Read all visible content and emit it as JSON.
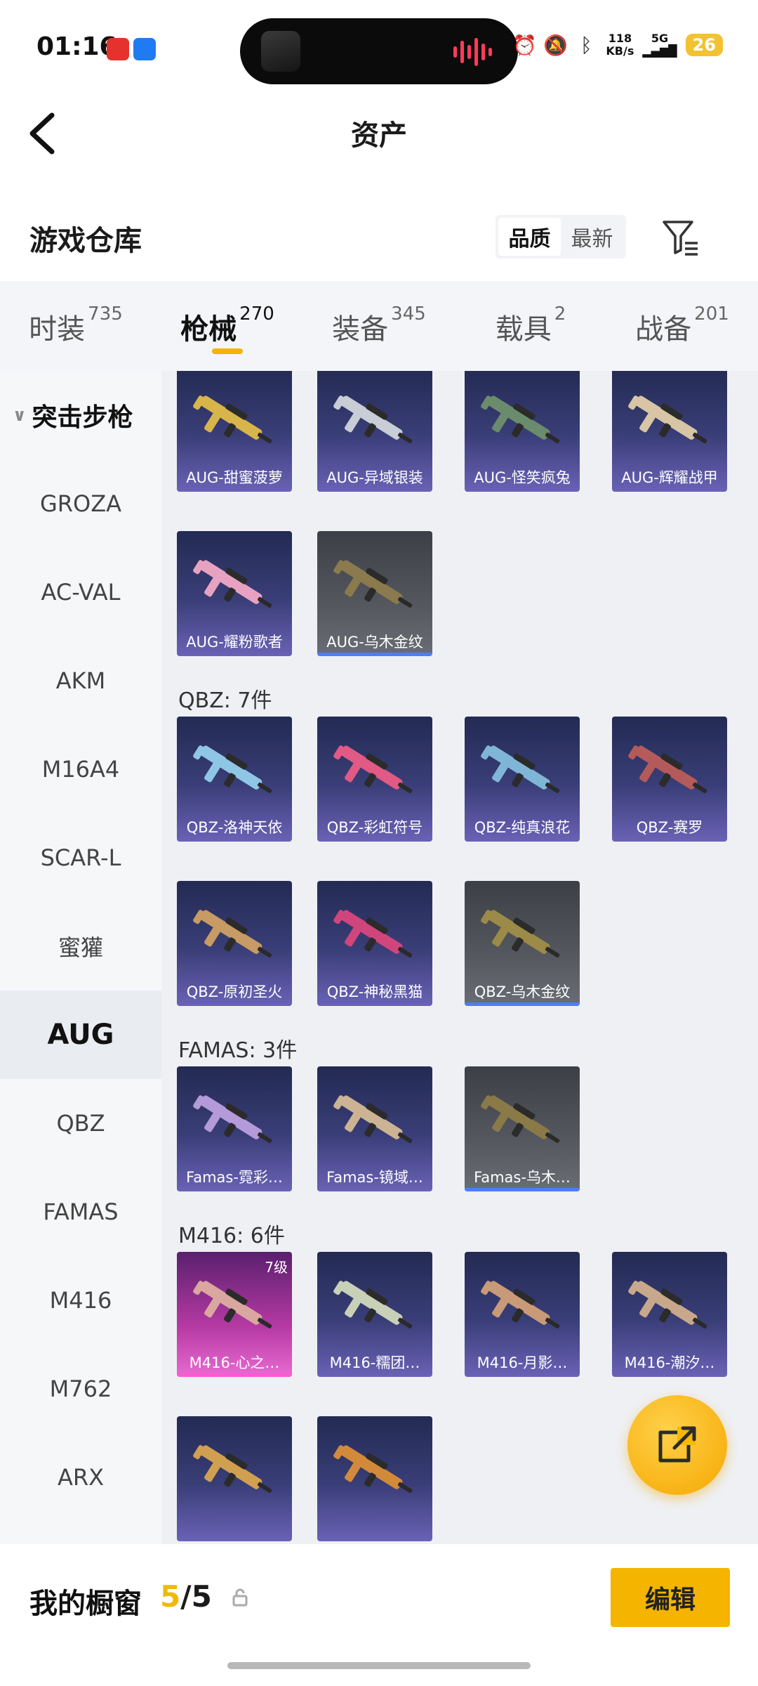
{
  "status_bar": {
    "time": "01:16",
    "net_speed_value": "118",
    "net_speed_unit": "KB/s",
    "network": "5G",
    "battery": "26"
  },
  "nav": {
    "title": "资产"
  },
  "section": {
    "title": "游戏仓库",
    "sort_options": [
      "品质",
      "最新"
    ],
    "active_sort": "品质"
  },
  "tabs": [
    {
      "label": "时装",
      "count": "735"
    },
    {
      "label": "枪械",
      "count": "270"
    },
    {
      "label": "装备",
      "count": "345"
    },
    {
      "label": "载具",
      "count": "2"
    },
    {
      "label": "战备",
      "count": "201"
    }
  ],
  "sidebar": {
    "group": "突击步枪",
    "items": [
      "GROZA",
      "AC-VAL",
      "AKM",
      "M16A4",
      "SCAR-L",
      "蜜獾",
      "AUG",
      "QBZ",
      "FAMAS",
      "M416",
      "M762",
      "ARX"
    ],
    "active": "AUG"
  },
  "groups": [
    {
      "title": "",
      "items": [
        "AUG-甜蜜菠萝",
        "AUG-异域银装",
        "AUG-怪笑疯兔",
        "AUG-辉耀战甲",
        "AUG-耀粉歌者",
        "AUG-乌木金纹"
      ]
    },
    {
      "title": "QBZ: 7件",
      "items": [
        "QBZ-洛神天依",
        "QBZ-彩虹符号",
        "QBZ-纯真浪花",
        "QBZ-赛罗",
        "QBZ-原初圣火",
        "QBZ-神秘黑猫",
        "QBZ-乌木金纹"
      ]
    },
    {
      "title": "FAMAS: 3件",
      "items": [
        "Famas-霓彩…",
        "Famas-镜域…",
        "Famas-乌木…"
      ]
    },
    {
      "title": "M416: 6件",
      "items": [
        "M416-心之…",
        "M416-糯团…",
        "M416-月影…",
        "M416-潮汐…",
        "",
        ""
      ],
      "level_badge": "7级"
    }
  ],
  "colors": {
    "accent": "#f4b400",
    "card_purple": "#3a3e78",
    "card_gray": "#55585f",
    "card_pink": "#b63aa3"
  },
  "bottom": {
    "label": "我的橱窗",
    "current": "5",
    "sep": "/",
    "total": "5",
    "edit": "编辑"
  }
}
